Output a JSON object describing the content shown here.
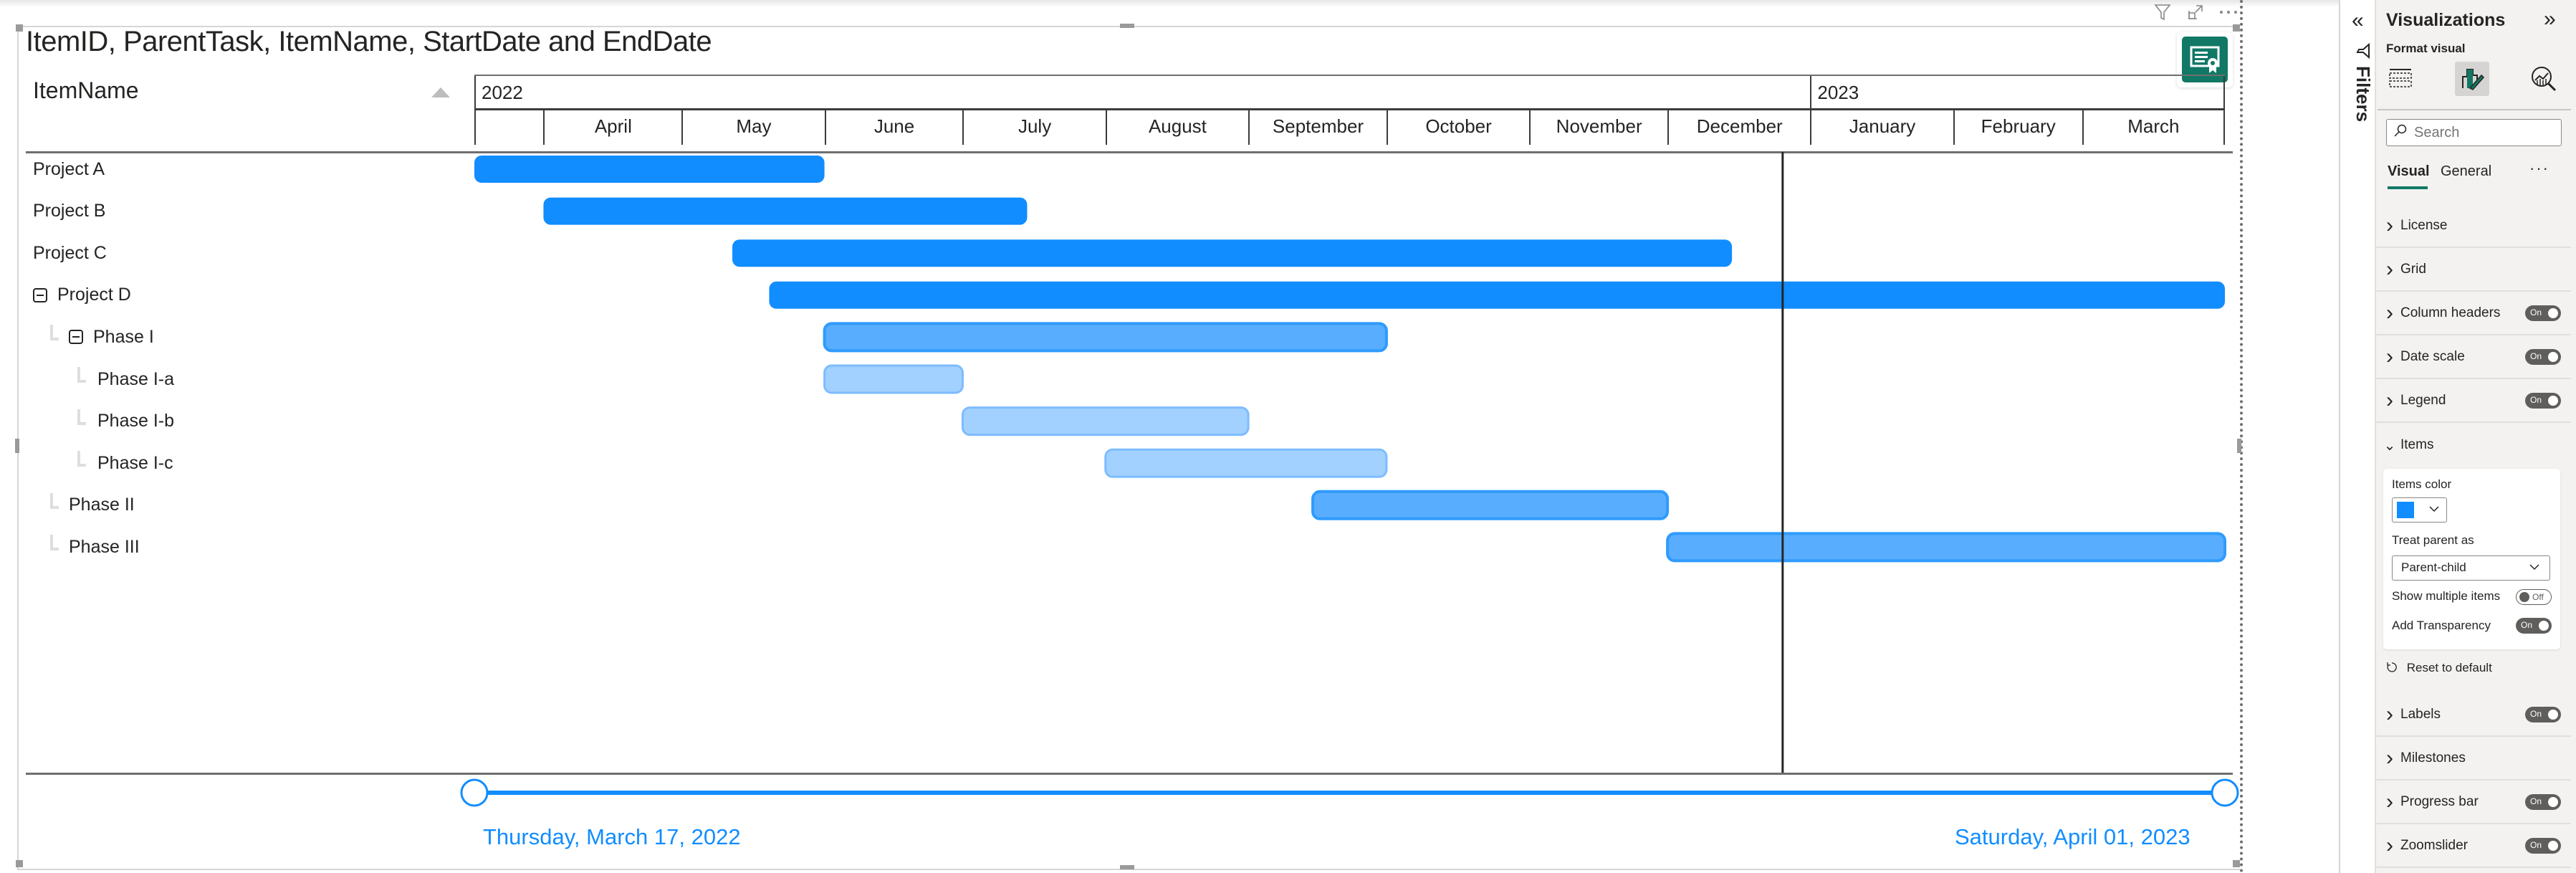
{
  "visual": {
    "title": "ItemID, ParentTask, ItemName, StartDate and EndDate",
    "header_icons": [
      "filter-icon",
      "focus-mode-icon",
      "more-options-icon"
    ],
    "certified_badge_icon": "certificate-icon",
    "column_header": "ItemName",
    "sort_icon": "sort-ascending-icon"
  },
  "chart_data": {
    "type": "gantt",
    "title": "ItemID, ParentTask, ItemName, StartDate and EndDate",
    "x_range": [
      "2022-03-17",
      "2023-04-01"
    ],
    "years": [
      {
        "label": "2022",
        "start": "2022-03-17",
        "end": "2023-01-01"
      },
      {
        "label": "2023",
        "start": "2023-01-01",
        "end": "2023-04-01"
      }
    ],
    "months": [
      {
        "label": "",
        "start": "2022-03-17",
        "end": "2022-04-01"
      },
      {
        "label": "April",
        "start": "2022-04-01",
        "end": "2022-05-01"
      },
      {
        "label": "May",
        "start": "2022-05-01",
        "end": "2022-06-01"
      },
      {
        "label": "June",
        "start": "2022-06-01",
        "end": "2022-07-01"
      },
      {
        "label": "July",
        "start": "2022-07-01",
        "end": "2022-08-01"
      },
      {
        "label": "August",
        "start": "2022-08-01",
        "end": "2022-09-01"
      },
      {
        "label": "September",
        "start": "2022-09-01",
        "end": "2022-10-01"
      },
      {
        "label": "October",
        "start": "2022-10-01",
        "end": "2022-11-01"
      },
      {
        "label": "November",
        "start": "2022-11-01",
        "end": "2022-12-01"
      },
      {
        "label": "December",
        "start": "2022-12-01",
        "end": "2023-01-01"
      },
      {
        "label": "January",
        "start": "2023-01-01",
        "end": "2023-02-01"
      },
      {
        "label": "February",
        "start": "2023-02-01",
        "end": "2023-03-01"
      },
      {
        "label": "March",
        "start": "2023-03-01",
        "end": "2023-04-01"
      }
    ],
    "items": [
      {
        "name": "Project A",
        "level": 0,
        "collapsible": false,
        "start": "2022-03-17",
        "end": "2022-06-01",
        "style": "parent"
      },
      {
        "name": "Project B",
        "level": 0,
        "collapsible": false,
        "start": "2022-04-01",
        "end": "2022-07-15",
        "style": "parent"
      },
      {
        "name": "Project C",
        "level": 0,
        "collapsible": false,
        "start": "2022-05-12",
        "end": "2022-12-15",
        "style": "parent"
      },
      {
        "name": "Project D",
        "level": 0,
        "collapsible": true,
        "start": "2022-05-20",
        "end": "2023-04-01",
        "style": "parent"
      },
      {
        "name": "Phase I",
        "level": 1,
        "collapsible": true,
        "start": "2022-06-01",
        "end": "2022-10-01",
        "style": "child"
      },
      {
        "name": "Phase I-a",
        "level": 2,
        "collapsible": false,
        "start": "2022-06-01",
        "end": "2022-07-01",
        "style": "grandchild"
      },
      {
        "name": "Phase I-b",
        "level": 2,
        "collapsible": false,
        "start": "2022-07-01",
        "end": "2022-09-01",
        "style": "grandchild"
      },
      {
        "name": "Phase I-c",
        "level": 2,
        "collapsible": false,
        "start": "2022-08-01",
        "end": "2022-10-01",
        "style": "grandchild"
      },
      {
        "name": "Phase II",
        "level": 1,
        "collapsible": false,
        "start": "2022-09-15",
        "end": "2022-12-01",
        "style": "child"
      },
      {
        "name": "Phase III",
        "level": 1,
        "collapsible": false,
        "start": "2022-12-01",
        "end": "2023-04-01",
        "style": "child"
      }
    ],
    "today_marker": "2022-12-26",
    "colors": {
      "parent": "#118dff",
      "child_fill": "#59adff",
      "child_border": "#2f9bff",
      "grandchild_fill": "#a2d1ff",
      "grandchild_border": "#7dbcff",
      "today_line": "#252423"
    }
  },
  "zoomslider": {
    "start_label": "Thursday, March 17, 2022",
    "end_label": "Saturday, April 01, 2023",
    "start_value": "2022-03-17",
    "end_value": "2023-04-01",
    "color": "#118dff"
  },
  "filters": {
    "label": "Filters",
    "collapse_icon": "double-chevron-left-icon"
  },
  "pane": {
    "title": "Visualizations",
    "subtitle": "Format visual",
    "tabs_icons": [
      "build-visual-icon",
      "format-visual-icon",
      "analytics-icon"
    ],
    "search_placeholder": "Search",
    "subtabs": [
      "Visual",
      "General"
    ],
    "active_subtab": "Visual",
    "sections_top": [
      {
        "label": "License",
        "toggle": null
      },
      {
        "label": "Grid",
        "toggle": null
      },
      {
        "label": "Column headers",
        "toggle": "On"
      },
      {
        "label": "Date scale",
        "toggle": "On"
      },
      {
        "label": "Legend",
        "toggle": "On"
      },
      {
        "label": "Items",
        "toggle": null,
        "expanded": true
      }
    ],
    "items_card": {
      "items_color_label": "Items color",
      "items_color": "#118dff",
      "treat_parent_label": "Treat parent as",
      "treat_parent_value": "Parent-child",
      "show_multiple_label": "Show multiple items",
      "show_multiple_toggle": "Off",
      "add_transparency_label": "Add Transparency",
      "add_transparency_toggle": "On"
    },
    "reset_label": "Reset to default",
    "sections_bottom": [
      {
        "label": "Labels",
        "toggle": "On"
      },
      {
        "label": "Milestones",
        "toggle": null
      },
      {
        "label": "Progress bar",
        "toggle": "On"
      },
      {
        "label": "Zoomslider",
        "toggle": "On"
      }
    ]
  }
}
